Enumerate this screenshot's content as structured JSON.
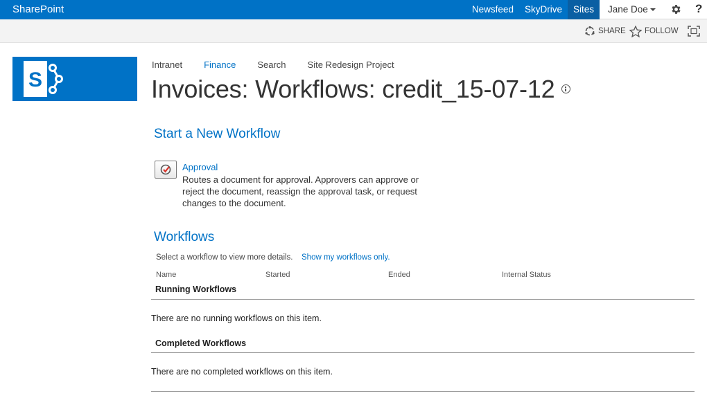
{
  "suite_bar": {
    "brand": "SharePoint",
    "links": [
      {
        "label": "Newsfeed"
      },
      {
        "label": "SkyDrive"
      },
      {
        "label": "Sites"
      }
    ],
    "user": "Jane Doe",
    "help_label": "?",
    "color": "#0072c6"
  },
  "ribbon": {
    "share_label": "SHARE",
    "follow_label": "FOLLOW"
  },
  "top_nav": [
    {
      "label": "Intranet"
    },
    {
      "label": "Finance"
    },
    {
      "label": "Search"
    },
    {
      "label": "Site Redesign Project"
    }
  ],
  "page": {
    "title": "Invoices: Workflows: credit_15-07-12"
  },
  "start_section": {
    "heading": "Start a New Workflow",
    "workflow": {
      "name": "Approval",
      "description": "Routes a document for approval. Approvers can approve or reject the document, reassign the approval task, or request changes to the document."
    }
  },
  "workflows_section": {
    "heading": "Workflows",
    "hint": "Select a workflow to view more details.",
    "filter_link": "Show my workflows only.",
    "columns": [
      "Name",
      "Started",
      "Ended",
      "Internal Status"
    ],
    "running": {
      "title": "Running Workflows",
      "empty": "There are no running workflows on this item."
    },
    "completed": {
      "title": "Completed Workflows",
      "empty": "There are no completed workflows on this item."
    }
  }
}
